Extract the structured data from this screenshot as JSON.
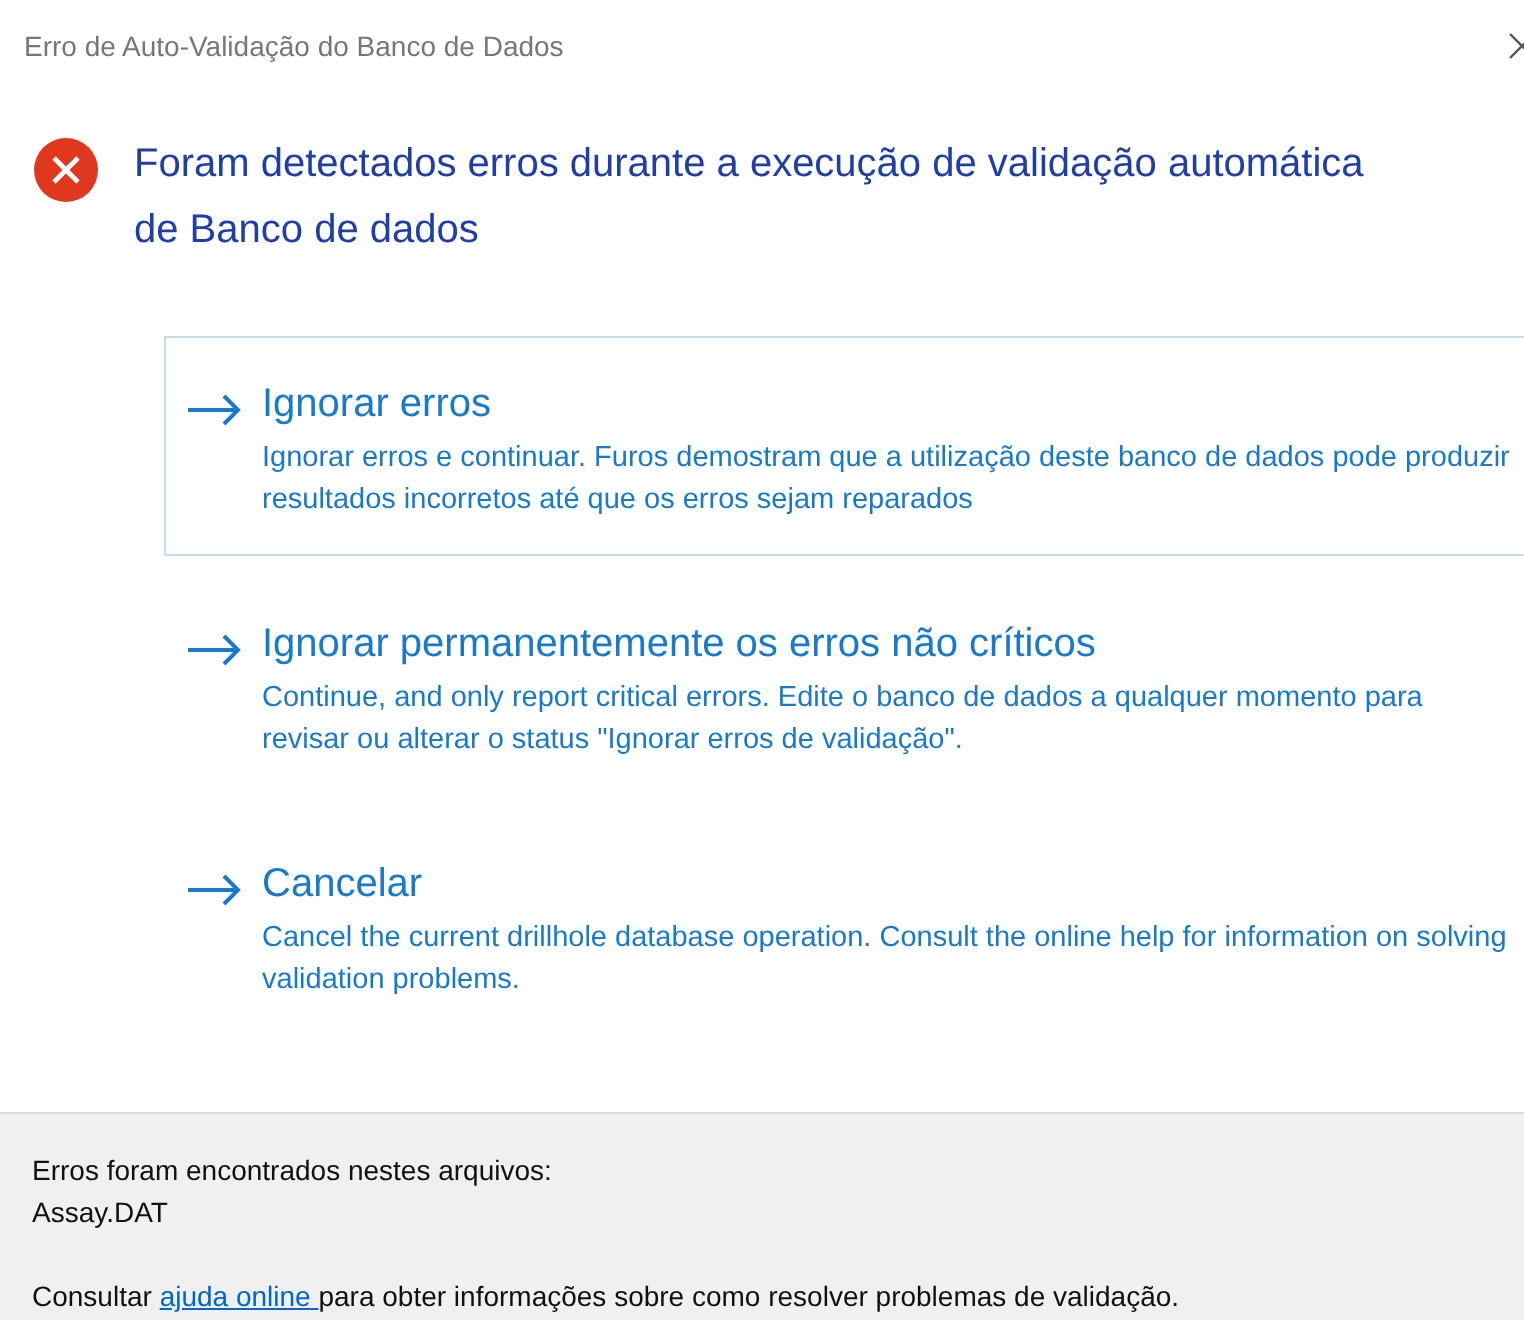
{
  "window": {
    "title": "Erro de Auto-Validação do Banco de Dados"
  },
  "heading": "Foram detectados erros durante a execução de validação automática de Banco de dados",
  "options": [
    {
      "title": "Ignorar erros",
      "description": "Ignorar erros e continuar. Furos demostram que a utilização deste banco de dados pode produzir resultados incorretos até que os erros sejam reparados",
      "selected": true
    },
    {
      "title": "Ignorar permanentemente os erros não críticos",
      "description": "Continue, and only report critical errors. Edite o banco de dados a qualquer momento para revisar ou alterar o status \"Ignorar erros de validação\".",
      "selected": false
    },
    {
      "title": "Cancelar",
      "description": "Cancel the current drillhole database operation. Consult the online help for information on solving validation problems.",
      "selected": false
    }
  ],
  "footer": {
    "files_label": "Erros foram encontrados nestes arquivos:",
    "files": [
      "Assay.DAT"
    ],
    "help_before": "Consultar",
    "help_link": "ajuda online ",
    "help_after": "para obter informações sobre como resolver problemas de validação."
  }
}
